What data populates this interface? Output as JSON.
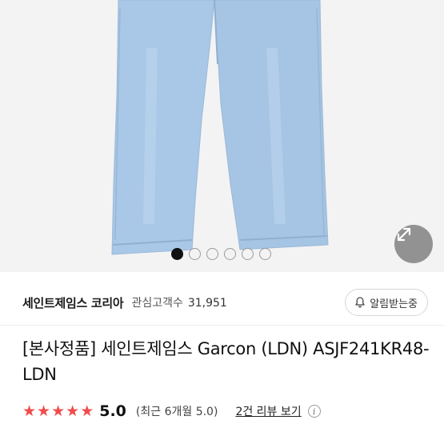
{
  "gallery": {
    "slide_count": 6,
    "active_index": 0,
    "expand_icon": "expand-diagonal-icon"
  },
  "seller": {
    "name": "세인트제임스 코리아",
    "followers_label": "관심고객수",
    "followers_count": "31,951",
    "alert_label": "알림받는중",
    "alert_icon": "bell-icon"
  },
  "product": {
    "title": "[본사정품] 세인트제임스 Garcon (LDN) ASJF241KR48-LDN"
  },
  "rating": {
    "stars": 5,
    "score": "5.0",
    "recent": "(최근 6개월 5.0)",
    "review_link": "2건 리뷰 보기",
    "star_color": "#f04c4c"
  },
  "colors": {
    "denim": "#a9c7e6",
    "accent_red": "#f04c4c"
  }
}
